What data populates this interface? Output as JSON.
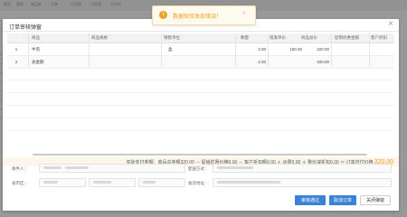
{
  "background": {
    "nav_tabs": [
      "首页",
      "我的",
      "商品库",
      "订单",
      "已完成",
      "已取消",
      "工作台"
    ]
  },
  "modal": {
    "title": "订单审核弹窗",
    "close_glyph": "×"
  },
  "table": {
    "headers": [
      "",
      "商品",
      "商品规格",
      "销售单位",
      "数量",
      "现发单价",
      "商品总价",
      "促销优惠金额",
      "客户折扣"
    ],
    "rows": [
      {
        "index": "1",
        "product": "牛肉",
        "spec": "",
        "unit": "盒",
        "qty": "2.00",
        "price": "160.00",
        "total": "320.00"
      },
      {
        "index": "2",
        "product": "总金额",
        "spec": "",
        "unit": "",
        "qty": "2.00",
        "price": "",
        "total": "320.00"
      }
    ]
  },
  "summary": {
    "text": "实际支付金额：商品总金额320.00 － 促销优惠价格0.00 － 客户折扣额0.00 ＋ 运费0.00 ＋ 整价减折扣0.00 ＝ 订单应付价格",
    "amount": "320.00"
  },
  "form": {
    "label_contact": "收件人：",
    "label_region": "省市区：",
    "label_delivery": "配送方式：",
    "label_address": "收货地址："
  },
  "buttons": {
    "approve": "审核通过",
    "cancel_order": "取消订单",
    "close": "关闭弹窗"
  },
  "toast": {
    "icon_glyph": "!",
    "message": "数据校验发现错误！",
    "close_glyph": "×"
  },
  "colors": {
    "primary": "#3b82d6",
    "warning": "#f0a020",
    "summary_bg": "#fdf5ea"
  },
  "icons": [
    "close-icon",
    "warning-icon"
  ]
}
